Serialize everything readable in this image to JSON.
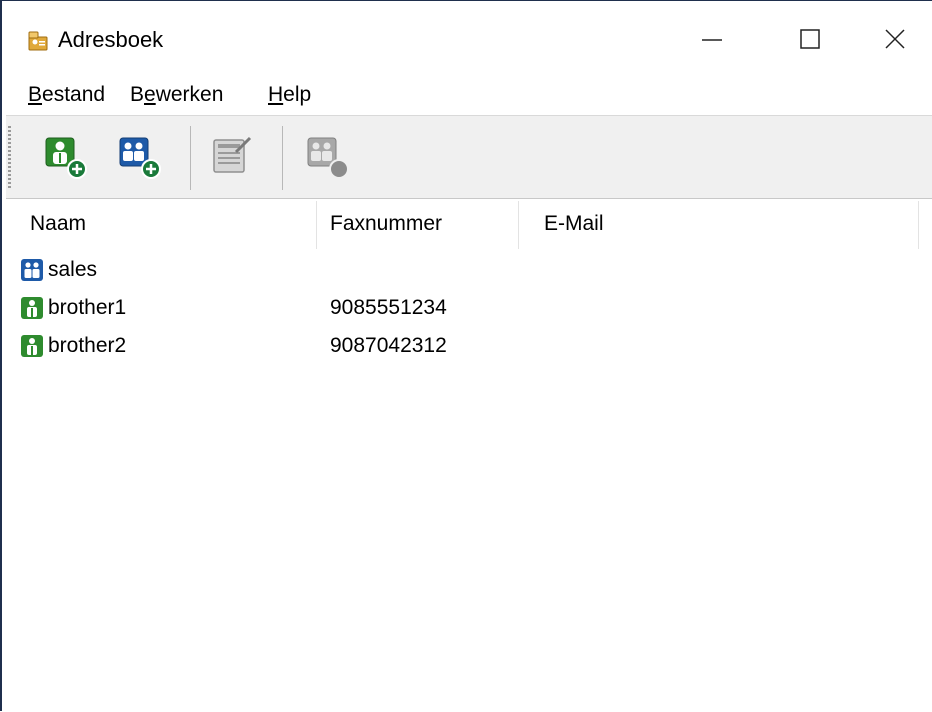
{
  "window": {
    "title": "Adresboek",
    "controls": [
      "minimize",
      "maximize",
      "close"
    ]
  },
  "menu": {
    "items": [
      {
        "label": "Bestand",
        "underline": "B"
      },
      {
        "label": "Bewerken",
        "underline": "e"
      },
      {
        "label": "Help",
        "underline": "H"
      }
    ]
  },
  "toolbar": {
    "buttons": [
      {
        "icon": "add-contact-icon",
        "enabled": true
      },
      {
        "icon": "add-group-icon",
        "enabled": true
      },
      {
        "icon": "edit-icon",
        "enabled": false
      },
      {
        "icon": "delete-icon",
        "enabled": false
      }
    ]
  },
  "list": {
    "columns": [
      "Naam",
      "Faxnummer",
      "E-Mail"
    ],
    "rows": [
      {
        "type": "group",
        "icon": "group-icon",
        "name": "sales",
        "fax": "",
        "email": ""
      },
      {
        "type": "person",
        "icon": "person-icon",
        "name": "brother1",
        "fax": "9085551234",
        "email": ""
      },
      {
        "type": "person",
        "icon": "person-icon",
        "name": "brother2",
        "fax": "9087042312",
        "email": ""
      }
    ]
  },
  "colors": {
    "person_green": "#2e8b2e",
    "group_blue": "#1e5aa8",
    "add_badge": "#1a7a3a",
    "toolbar_bg": "#f0f0f0"
  }
}
